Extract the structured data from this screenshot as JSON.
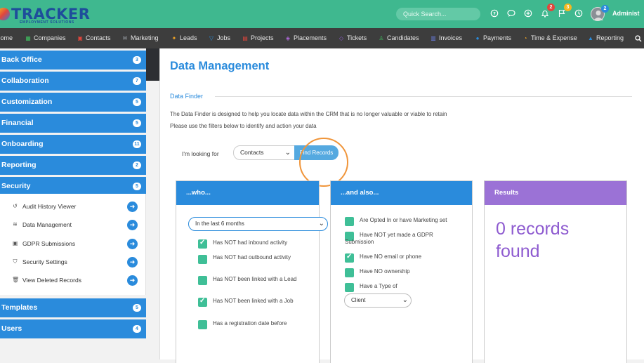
{
  "header": {
    "logo_main": "TRACKER",
    "logo_sub": "EMPLOYMENT SOLUTIONS",
    "search_placeholder": "Quick Search...",
    "notifications_count": "2",
    "flags_count": "3",
    "avatar_count": "2",
    "user_label": "Administ"
  },
  "nav": [
    {
      "label": "Home",
      "icon": "home-icon"
    },
    {
      "label": "Companies",
      "icon": "companies-icon",
      "color": "#3fbf5f"
    },
    {
      "label": "Contacts",
      "icon": "contacts-icon",
      "color": "#e2463c"
    },
    {
      "label": "Marketing",
      "icon": "marketing-icon",
      "color": "#9aa0a6"
    },
    {
      "label": "Leads",
      "icon": "leads-icon",
      "color": "#f5a623"
    },
    {
      "label": "Jobs",
      "icon": "jobs-icon",
      "color": "#2a8bdc"
    },
    {
      "label": "Projects",
      "icon": "projects-icon",
      "color": "#e2463c"
    },
    {
      "label": "Placements",
      "icon": "placements-icon",
      "color": "#b36be0"
    },
    {
      "label": "Tickets",
      "icon": "tickets-icon",
      "color": "#8e5bd0"
    },
    {
      "label": "Candidates",
      "icon": "candidates-icon",
      "color": "#3fbf5f"
    },
    {
      "label": "Invoices",
      "icon": "invoices-icon",
      "color": "#6a7de0"
    },
    {
      "label": "Payments",
      "icon": "payments-icon",
      "color": "#2a8bdc"
    },
    {
      "label": "Time & Expense",
      "icon": "time-icon",
      "color": "#f5a623"
    },
    {
      "label": "Reporting",
      "icon": "reporting-icon",
      "color": "#2a8bdc"
    }
  ],
  "sidebar": {
    "groups": [
      {
        "label": "Back Office",
        "count": "3"
      },
      {
        "label": "Collaboration",
        "count": "7"
      },
      {
        "label": "Customization",
        "count": "5"
      },
      {
        "label": "Financial",
        "count": "5"
      },
      {
        "label": "Onboarding",
        "count": "11"
      },
      {
        "label": "Reporting",
        "count": "2"
      },
      {
        "label": "Security",
        "count": "5"
      },
      {
        "label": "Templates",
        "count": "5"
      },
      {
        "label": "Users",
        "count": "4"
      }
    ],
    "security_items": [
      {
        "label": "Audit History Viewer",
        "icon": "history-icon"
      },
      {
        "label": "Data Management",
        "icon": "database-icon"
      },
      {
        "label": "GDPR Submissions",
        "icon": "gdpr-icon"
      },
      {
        "label": "Security Settings",
        "icon": "shield-icon"
      },
      {
        "label": "View Deleted Records",
        "icon": "trash-icon"
      }
    ]
  },
  "main": {
    "title": "Data Management",
    "section_title": "Data Finder",
    "description_1": "The Data Finder is designed to help you locate data within the CRM that is no longer valuable or viable to retain",
    "description_2": "Please use the filters below to identify and action your data",
    "looking_for_label": "I'm looking for",
    "looking_for_value": "Contacts",
    "find_button": "Find Records",
    "who": {
      "title": "...who...",
      "period": "In the last 6 months",
      "options": [
        {
          "label": "Has NOT had inbound activity",
          "checked": true
        },
        {
          "label": "Has NOT had outbound activity",
          "checked": false
        },
        {
          "label": "Has NOT been linked with a Lead",
          "checked": false
        },
        {
          "label": "Has NOT been linked with a Job",
          "checked": true
        },
        {
          "label": "Has a registration date before",
          "checked": false
        }
      ]
    },
    "also": {
      "title": "...and also...",
      "options": [
        {
          "label": "Are Opted In or have Marketing set",
          "checked": false
        },
        {
          "label": "Have NOT yet made a GDPR Submission",
          "checked": false
        },
        {
          "label": "Have NO email or phone",
          "checked": true
        },
        {
          "label": "Have NO ownership",
          "checked": false
        },
        {
          "label": "Have a Type of",
          "checked": false
        }
      ],
      "type_value": "Client"
    },
    "results": {
      "title": "Results",
      "line_1": "0 records",
      "line_2": "found"
    }
  },
  "colors": {
    "header_green": "#3fb88f",
    "nav_dark": "#3d3d3d",
    "primary_blue": "#2a8bdc",
    "results_purple": "#9b72d6",
    "checkbox_green": "#3fbf97",
    "highlight_orange": "#f0953a"
  }
}
